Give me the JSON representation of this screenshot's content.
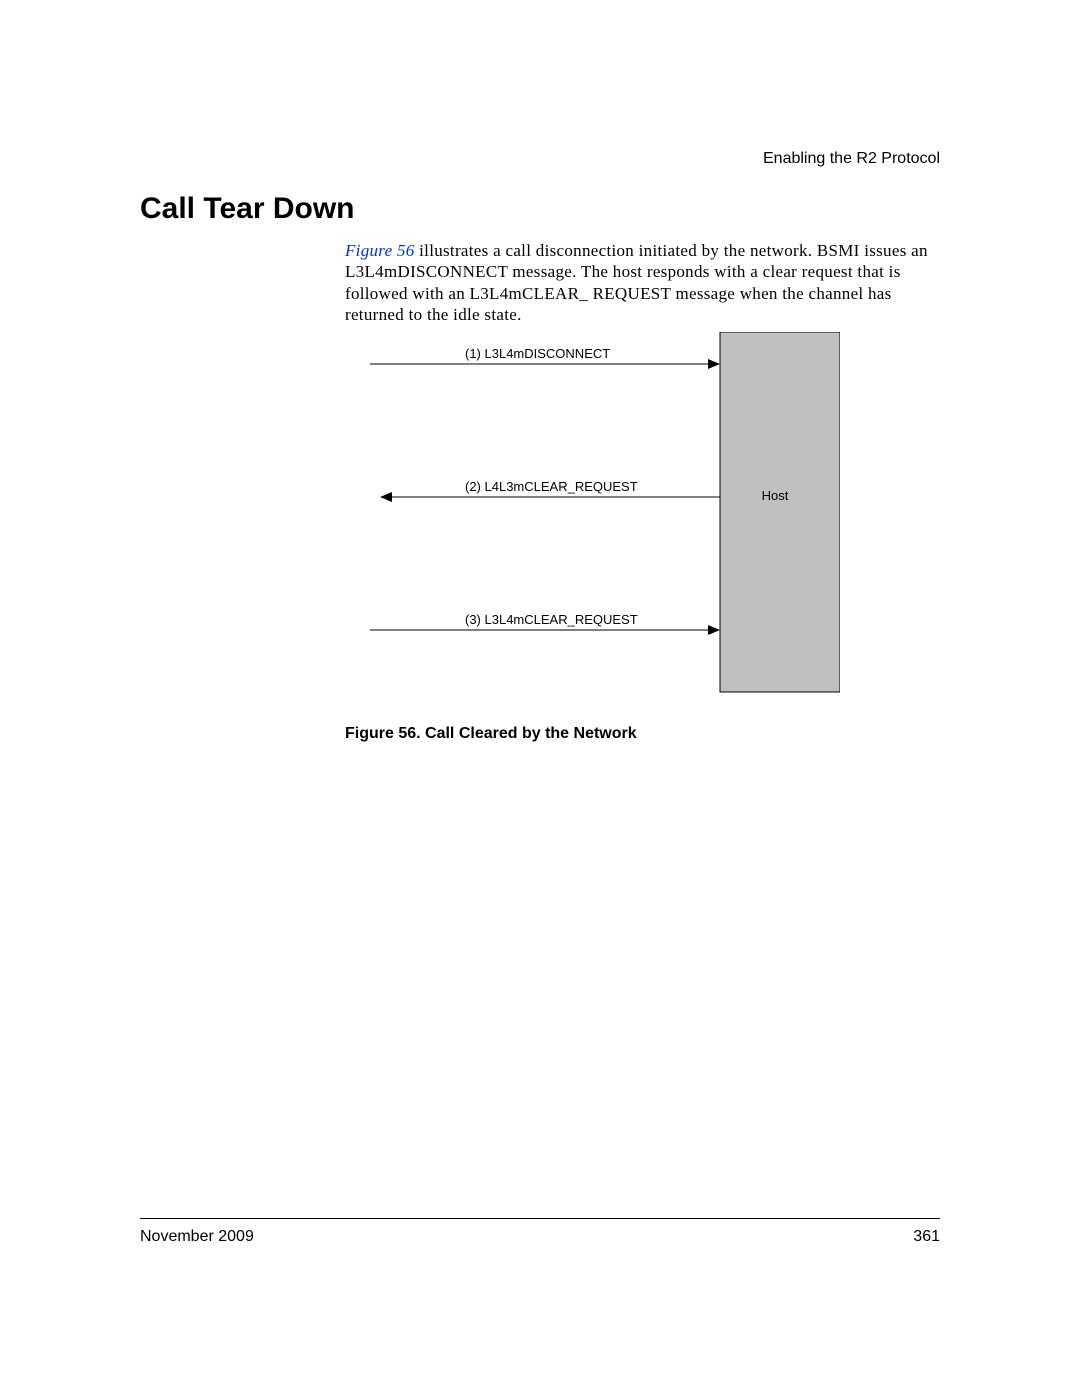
{
  "header": {
    "right": "Enabling the R2 Protocol"
  },
  "section": {
    "title": "Call Tear Down"
  },
  "paragraph": {
    "figref": "Figure 56",
    "rest": " illustrates a call disconnection initiated by the network. BSMI issues an L3L4mDISCONNECT message. The host responds with a clear request that is followed with an L3L4mCLEAR_ REQUEST message when the channel has returned to the idle state."
  },
  "diagram": {
    "arrow1": "(1) L3L4mDISCONNECT",
    "arrow2": "(2) L4L3mCLEAR_REQUEST",
    "arrow3": "(3) L3L4mCLEAR_REQUEST",
    "host": "Host"
  },
  "figure": {
    "caption": "Figure 56.   Call Cleared by the Network"
  },
  "footer": {
    "left": "November 2009",
    "right": "361"
  }
}
